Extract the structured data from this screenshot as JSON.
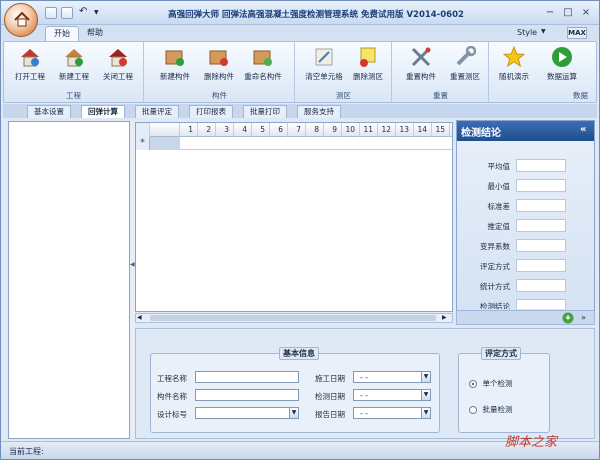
{
  "window": {
    "title": "高强回弹大师 回弹法高强混凝土强度检测管理系统 免费试用版 V2014-0602",
    "controls": [
      "−",
      "□",
      "×"
    ]
  },
  "ribbon_tabs": [
    "开始",
    "帮助"
  ],
  "style_label": "Style",
  "max_label": "MAX",
  "ribbon_groups": [
    {
      "label": "工程",
      "buttons": [
        "打开工程",
        "新建工程",
        "关闭工程"
      ],
      "icons": [
        "house-open-icon",
        "house-new-icon",
        "house-close-icon"
      ]
    },
    {
      "label": "构件",
      "buttons": [
        "新建构件",
        "删除构件",
        "重命名构件"
      ],
      "icons": [
        "box-add-icon",
        "box-delete-icon",
        "box-rename-icon"
      ]
    },
    {
      "label": "测区",
      "buttons": [
        "清空单元格",
        "删除测区"
      ],
      "icons": [
        "clear-cells-icon",
        "delete-zone-icon"
      ]
    },
    {
      "label": "重置",
      "buttons": [
        "重置构件",
        "重置测区"
      ],
      "icons": [
        "tools-icon",
        "wrench-icon"
      ]
    },
    {
      "label": "数据",
      "buttons": [
        "随机演示",
        "数据运算"
      ],
      "icons": [
        "star-icon",
        "play-icon"
      ]
    }
  ],
  "sub_tabs": [
    "基本设置",
    "回弹计算",
    "批量评定",
    "打印报表",
    "批量打印",
    "服务支持"
  ],
  "grid": {
    "columns": [
      "1",
      "2",
      "3",
      "4",
      "5",
      "6",
      "7",
      "8",
      "9",
      "10",
      "11",
      "12",
      "13",
      "14",
      "15"
    ],
    "new_row_marker": "*"
  },
  "result_panel": {
    "title": "检测结论",
    "collapse": "«",
    "fields": [
      "平均值",
      "最小值",
      "标准差",
      "推定值",
      "变异系数",
      "评定方式",
      "统计方式",
      "检测结论"
    ]
  },
  "basic_info": {
    "title": "基本信息",
    "project_name_label": "工程名称",
    "member_name_label": "构件名称",
    "design_grade_label": "设计标号",
    "construction_date_label": "施工日期",
    "test_date_label": "检测日期",
    "report_date_label": "报告日期",
    "date_placeholder": "-   -"
  },
  "eval_method": {
    "title": "评定方式",
    "options": [
      "单个检测",
      "批量检测"
    ],
    "selected": "单个检测"
  },
  "status": {
    "current_project_label": "当前工程:"
  },
  "watermark": "脚本之家",
  "colors": {
    "accent": "#1f4e8f",
    "ribbon_bg": "#dfe8f5"
  }
}
